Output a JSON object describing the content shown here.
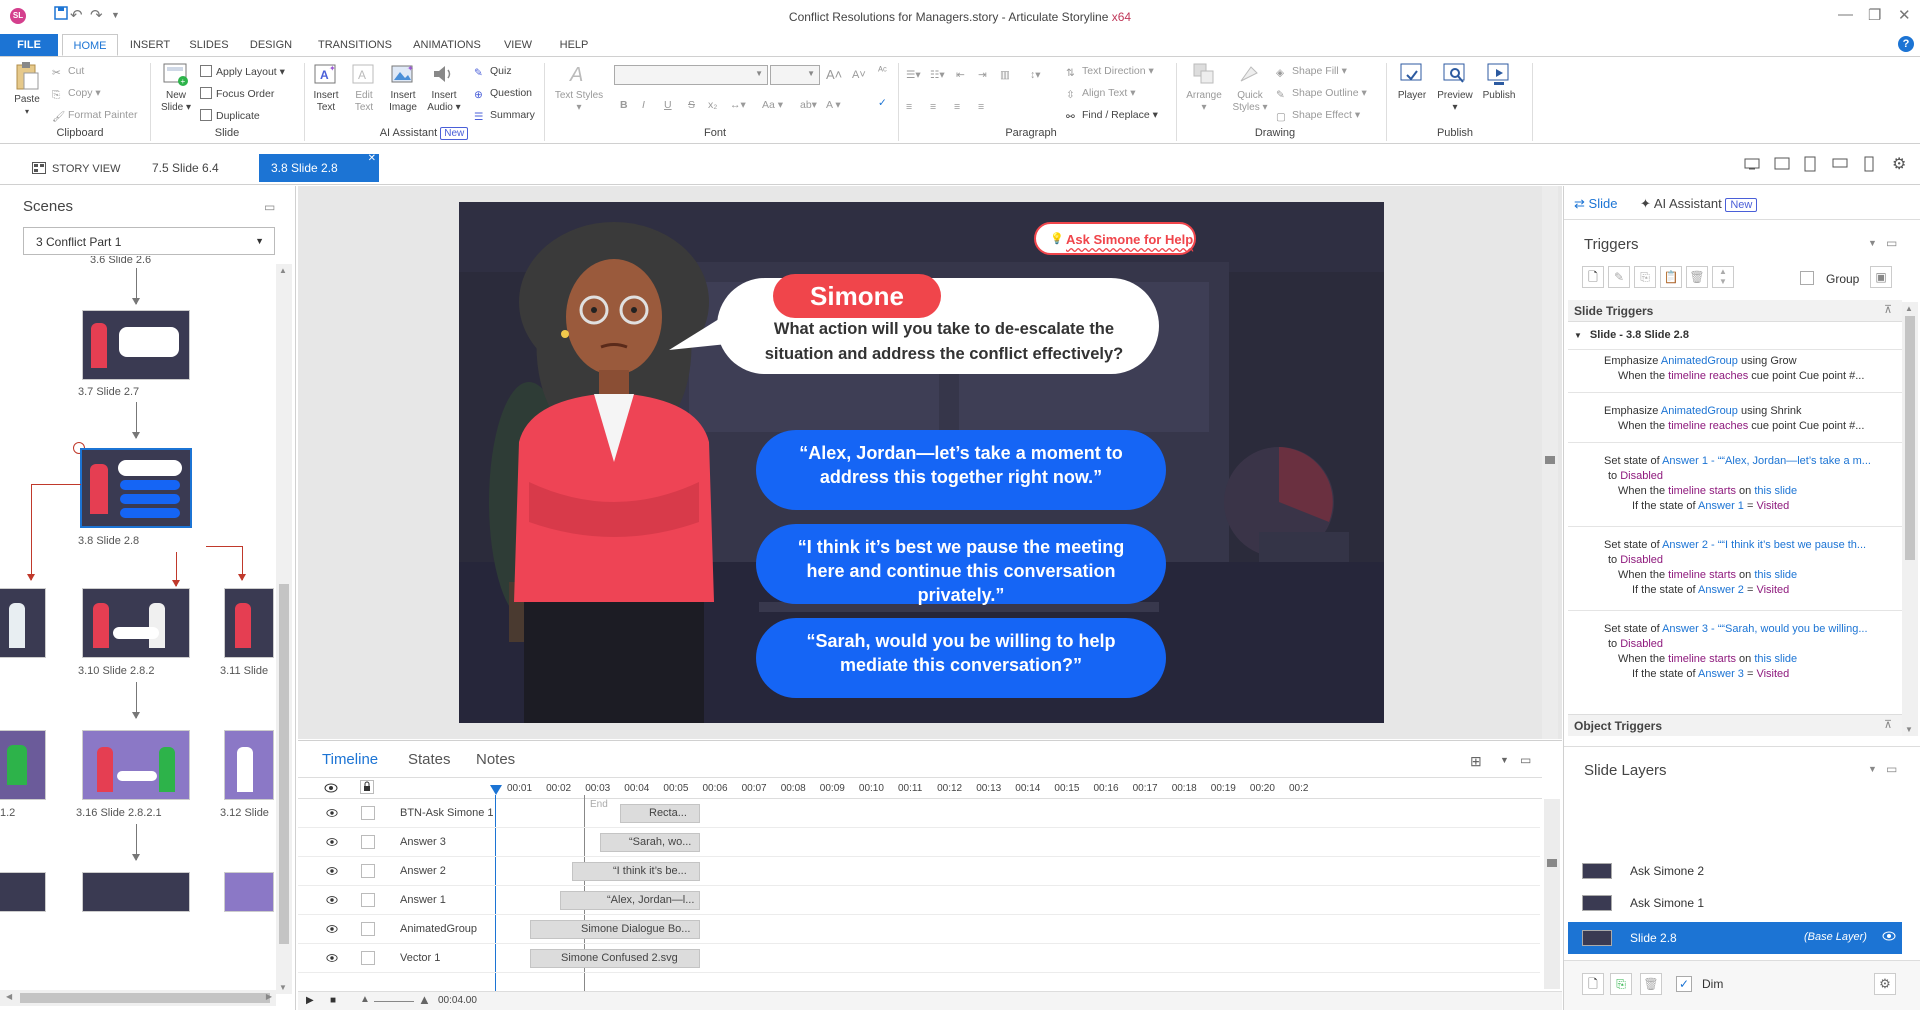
{
  "window": {
    "title": "Conflict Resolutions for Managers.story - Articulate Storyline",
    "title_suffix": "x64",
    "logo": "SL"
  },
  "ribbon_tabs": [
    "FILE",
    "HOME",
    "INSERT",
    "SLIDES",
    "DESIGN",
    "TRANSITIONS",
    "ANIMATIONS",
    "VIEW",
    "HELP"
  ],
  "clipboard": {
    "paste": "Paste",
    "cut": "Cut",
    "copy": "Copy",
    "format_painter": "Format Painter",
    "group": "Clipboard"
  },
  "slide_group": {
    "new_slide": "New Slide",
    "apply_layout": "Apply Layout",
    "focus_order": "Focus Order",
    "duplicate": "Duplicate",
    "group": "Slide"
  },
  "ai_group": {
    "insert_text": "Insert Text",
    "edit_text": "Edit Text",
    "insert_image": "Insert Image",
    "insert_audio": "Insert Audio",
    "quiz": "Quiz",
    "question": "Question",
    "summary": "Summary",
    "group": "AI Assistant",
    "new_badge": "New"
  },
  "font_group": {
    "text_styles": "Text Styles",
    "group": "Font",
    "bold": "B",
    "italic": "I",
    "underline": "U",
    "strike": "S",
    "aa": "Aa"
  },
  "paragraph_group": {
    "text_direction": "Text Direction",
    "align_text": "Align Text",
    "find_replace": "Find / Replace",
    "group": "Paragraph"
  },
  "drawing_group": {
    "arrange": "Arrange",
    "quick_styles": "Quick Styles",
    "shape_fill": "Shape Fill",
    "shape_outline": "Shape Outline",
    "shape_effect": "Shape Effect",
    "group": "Drawing"
  },
  "publish_group": {
    "player": "Player",
    "preview": "Preview",
    "publish": "Publish",
    "group": "Publish"
  },
  "view_tabs": {
    "story_view": "STORY VIEW",
    "tab1": "7.5 Slide 6.4",
    "tab2": "3.8 Slide 2.8"
  },
  "scenes": {
    "title": "Scenes",
    "selected_scene": "3 Conflict Part 1",
    "cut_label": "3.6 Slide 2.6",
    "thumbs": [
      {
        "label": "3.7 Slide 2.7"
      },
      {
        "label": "3.8 Slide 2.8"
      },
      {
        "label": "3.10 Slide 2.8.2"
      },
      {
        "label": "3.11 Slide"
      },
      {
        "label": "1.2"
      },
      {
        "label": "3.16 Slide 2.8.2.1"
      },
      {
        "label": "3.12 Slide"
      }
    ]
  },
  "slide": {
    "ask_button": "Ask Simone for Help",
    "name": "Simone",
    "question": "What action will you take to de-escalate the situation and address the conflict effectively?",
    "answers": [
      "“Alex, Jordan—let’s take a moment to address this together right now.”",
      "“I think it’s best we pause the meeting here and continue this conversation privately.”",
      "“Sarah, would you be willing to help mediate this conversation?”"
    ],
    "colors": {
      "accent": "#f0454b",
      "answer": "#1565f5",
      "bg": "#2c2c3a"
    }
  },
  "timeline": {
    "tabs": [
      "Timeline",
      "States",
      "Notes"
    ],
    "ticks": [
      "00:01",
      "00:02",
      "00:03",
      "00:04",
      "00:05",
      "00:06",
      "00:07",
      "00:08",
      "00:09",
      "00:10",
      "00:11",
      "00:12",
      "00:13",
      "00:14",
      "00:15",
      "00:16",
      "00:17",
      "00:18",
      "00:19",
      "00:20",
      "00:2"
    ],
    "end_label": "End",
    "current_time": "00:04.00",
    "rows": [
      {
        "name": "BTN-Ask Simone 1",
        "bar": "Recta..."
      },
      {
        "name": "Answer 3",
        "bar": "“Sarah, wo..."
      },
      {
        "name": "Answer 2",
        "bar": "“I think it’s be..."
      },
      {
        "name": "Answer 1",
        "bar": "“Alex, Jordan—l..."
      },
      {
        "name": "AnimatedGroup",
        "bar": "Simone Dialogue Bo..."
      },
      {
        "name": "Vector 1",
        "bar": "Simone Confused 2.svg"
      }
    ]
  },
  "right_panel": {
    "tab_slide": "Slide",
    "tab_ai": "AI Assistant",
    "new_badge": "New",
    "triggers_title": "Triggers",
    "group_label": "Group",
    "slide_triggers": "Slide Triggers",
    "slide_node": "Slide - 3.8 Slide 2.8",
    "t1_a": "Emphasize ",
    "t1_b": "AnimatedGroup",
    "t1_c": " using Grow",
    "t1_d": "When the ",
    "t1_e": "timeline reaches",
    "t1_f": " cue point Cue point #...",
    "t2_a": "Emphasize ",
    "t2_b": "AnimatedGroup",
    "t2_c": " using Shrink",
    "t2_d": "When the ",
    "t2_e": "timeline reaches",
    "t2_f": " cue point Cue point #...",
    "t3_a": "Set state of ",
    "t3_b": "Answer 1 - ““Alex, Jordan—let’s take a m...",
    "t3_c": "to ",
    "t3_d": "Disabled",
    "t3_e": "When the ",
    "t3_f": "timeline starts",
    "t3_g": " on ",
    "t3_h": "this slide",
    "t3_i": "If the state of ",
    "t3_j": "Answer 1",
    "t3_k": " = ",
    "t3_l": "Visited",
    "t4_a": "Set state of ",
    "t4_b": "Answer 2 - ““I think it’s best we pause th...",
    "t4_c": "to ",
    "t4_d": "Disabled",
    "t4_e": "When the ",
    "t4_f": "timeline starts",
    "t4_g": " on ",
    "t4_h": "this slide",
    "t4_i": "If the state of ",
    "t4_j": "Answer 2",
    "t4_k": " = ",
    "t4_l": "Visited",
    "t5_a": "Set state of ",
    "t5_b": "Answer 3 - ““Sarah, would you be willing...",
    "t5_c": "to ",
    "t5_d": "Disabled",
    "t5_e": "When the ",
    "t5_f": "timeline starts",
    "t5_g": " on ",
    "t5_h": "this slide",
    "t5_i": "If the state of ",
    "t5_j": "Answer 3",
    "t5_k": " = ",
    "t5_l": "Visited",
    "object_triggers": "Object Triggers",
    "slide_layers": "Slide Layers",
    "layers": [
      {
        "name": "Ask Simone 2",
        "tag": ""
      },
      {
        "name": "Ask Simone 1",
        "tag": ""
      },
      {
        "name": "Slide 2.8",
        "tag": "(Base Layer)"
      }
    ],
    "dim_label": "Dim"
  }
}
